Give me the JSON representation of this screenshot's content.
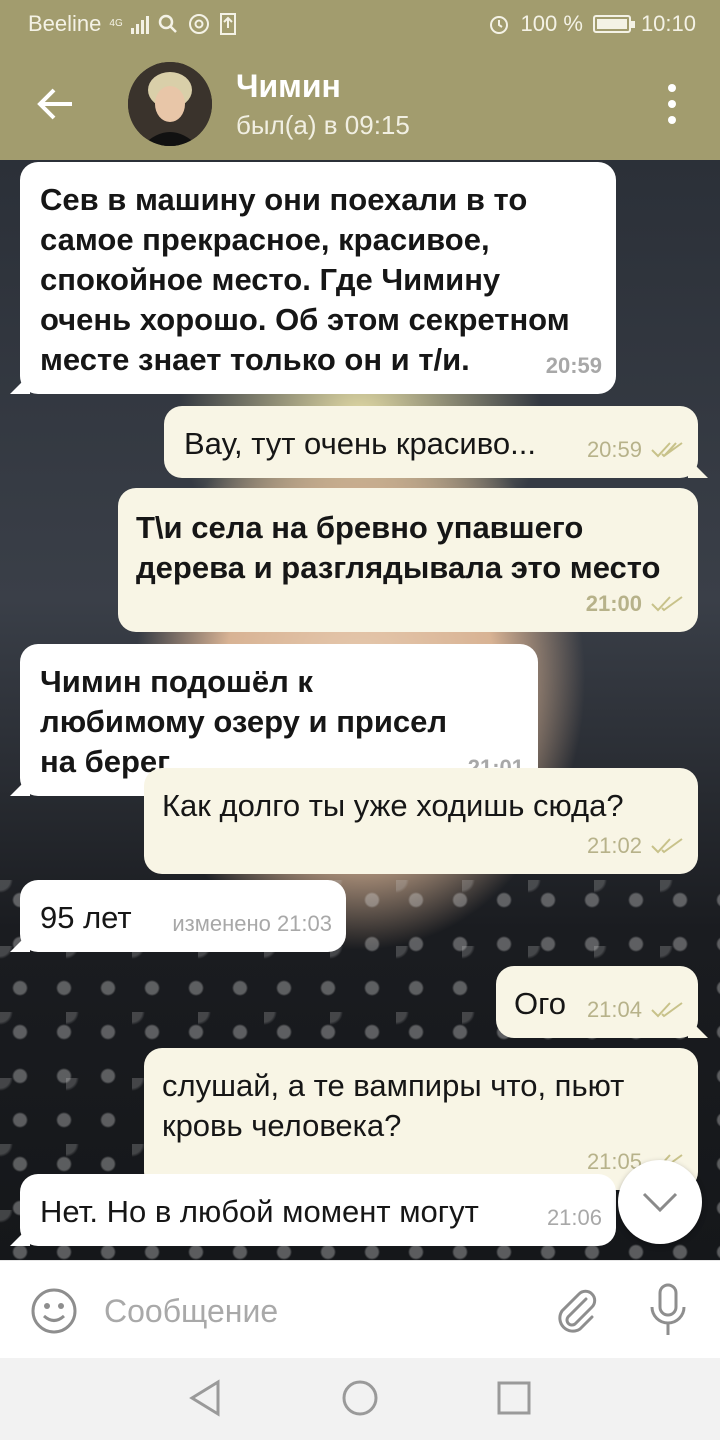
{
  "status_bar": {
    "carrier": "Beeline",
    "network": "4G",
    "battery": "100 %",
    "time": "10:10",
    "icons": [
      "signal-icon",
      "search-icon",
      "at-icon",
      "upload-icon",
      "alarm-icon",
      "battery-icon"
    ]
  },
  "header": {
    "name": "Чимин",
    "status": "был(а) в 09:15"
  },
  "messages": [
    {
      "dir": "in",
      "text": "Сев в машину они поехали в то самое прекрасное, красивое, спокойное место. Где Чимину очень хорошо. Об этом секретном месте знает только он и т/и.",
      "time": "20:59"
    },
    {
      "dir": "out",
      "text": "Вау, тут очень красиво...",
      "time": "20:59"
    },
    {
      "dir": "out",
      "text": "Т\\и села на бревно упавшего дерева и разглядывала это место",
      "time": "21:00"
    },
    {
      "dir": "in",
      "text": "Чимин подошёл к любимому озеру и присел на берег",
      "time": "21:01"
    },
    {
      "dir": "out",
      "text": "Как долго ты уже ходишь сюда?",
      "time": "21:02"
    },
    {
      "dir": "in",
      "text": "95 лет",
      "time": "изменено 21:03"
    },
    {
      "dir": "out",
      "text": "Ого",
      "time": "21:04"
    },
    {
      "dir": "out",
      "text": "слушай, а те вампиры что, пьют кровь человека?",
      "time": "21:05"
    },
    {
      "dir": "in",
      "text": "Нет. Но в любой момент могут",
      "time": "21:06"
    }
  ],
  "input": {
    "placeholder": "Сообщение"
  },
  "colors": {
    "header": "#a29c6e",
    "bubble_in": "#ffffff",
    "bubble_out": "#f8f5e5",
    "check": "#c8c28a"
  }
}
